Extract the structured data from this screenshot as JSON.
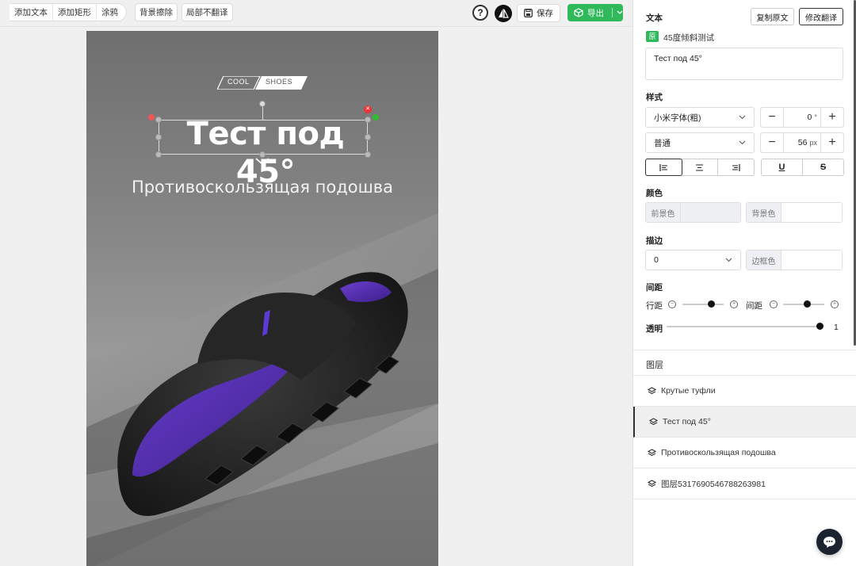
{
  "toolbar": {
    "tools": [
      "添加文本",
      "添加矩形",
      "涂鸦"
    ],
    "bg_erase": "背景擦除",
    "partial_no_translate": "局部不翻译",
    "save_label": "保存",
    "export_label": "导出"
  },
  "canvas": {
    "badge_left": "COOL",
    "badge_right": "SHOES",
    "title": "Тест под 45°",
    "subtitle": "Противоскользящая подошва"
  },
  "panel": {
    "text_section": "文本",
    "copy_original": "复制原文",
    "modify_translation": "修改翻译",
    "original_tag": "原",
    "original_text": "45度倾斜测试",
    "translated_text": "Тест под 45°",
    "style_section": "样式",
    "font_family": "小米字体(粗)",
    "rotation_value": "0",
    "rotation_unit": "°",
    "weight": "普通",
    "font_size_value": "56",
    "font_size_unit": "px",
    "color_section": "颜色",
    "fg_color_label": "前景色",
    "bg_color_label": "背景色",
    "stroke_section": "描边",
    "stroke_value": "0",
    "stroke_color_label": "边框色",
    "spacing_section": "间距",
    "line_spacing_label": "行距",
    "letter_spacing_label": "间距",
    "line_spacing_level": 0.5,
    "letter_spacing_level": 0.55,
    "opacity_label": "透明",
    "opacity_value": "1",
    "layers_section": "图层",
    "layers": [
      {
        "name": "Крутые туфли"
      },
      {
        "name": "Тест под 45°"
      },
      {
        "name": "Противоскользящая подошва"
      },
      {
        "name": "图层5317690546788263981"
      }
    ]
  },
  "colors": {
    "accent_green": "#2fb95a",
    "selected_layer_bg": "#f0f0f0",
    "chat_button": "#1b2330"
  }
}
